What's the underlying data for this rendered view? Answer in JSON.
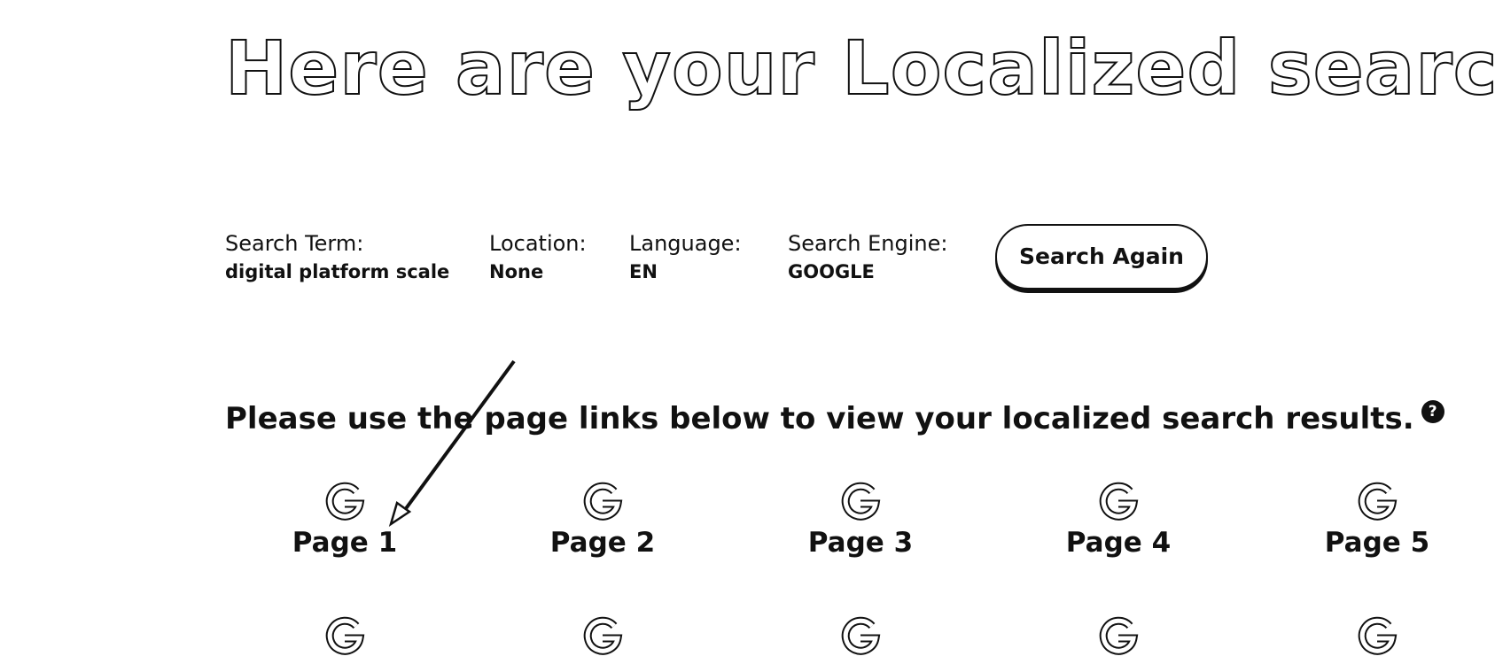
{
  "header": {
    "title": "Here are your Localized search results"
  },
  "search_meta": {
    "term_label": "Search Term:",
    "term_value": "digital platform scale",
    "location_label": "Location:",
    "location_value": "None",
    "language_label": "Language:",
    "language_value": "EN",
    "engine_label": "Search Engine:",
    "engine_value": "GOOGLE"
  },
  "actions": {
    "search_again_label": "Search Again"
  },
  "instructions": {
    "text": "Please use the page links below to view your localized search results.",
    "help_icon_glyph": "?"
  },
  "pages": [
    {
      "label": "Page 1",
      "icon": "google-icon"
    },
    {
      "label": "Page 2",
      "icon": "google-icon"
    },
    {
      "label": "Page 3",
      "icon": "google-icon"
    },
    {
      "label": "Page 4",
      "icon": "google-icon"
    },
    {
      "label": "Page 5",
      "icon": "google-icon"
    },
    {
      "label": "",
      "icon": "google-icon"
    },
    {
      "label": "",
      "icon": "google-icon"
    },
    {
      "label": "",
      "icon": "google-icon"
    },
    {
      "label": "",
      "icon": "google-icon"
    },
    {
      "label": "",
      "icon": "google-icon"
    }
  ],
  "colors": {
    "text": "#111111",
    "background": "#ffffff"
  }
}
